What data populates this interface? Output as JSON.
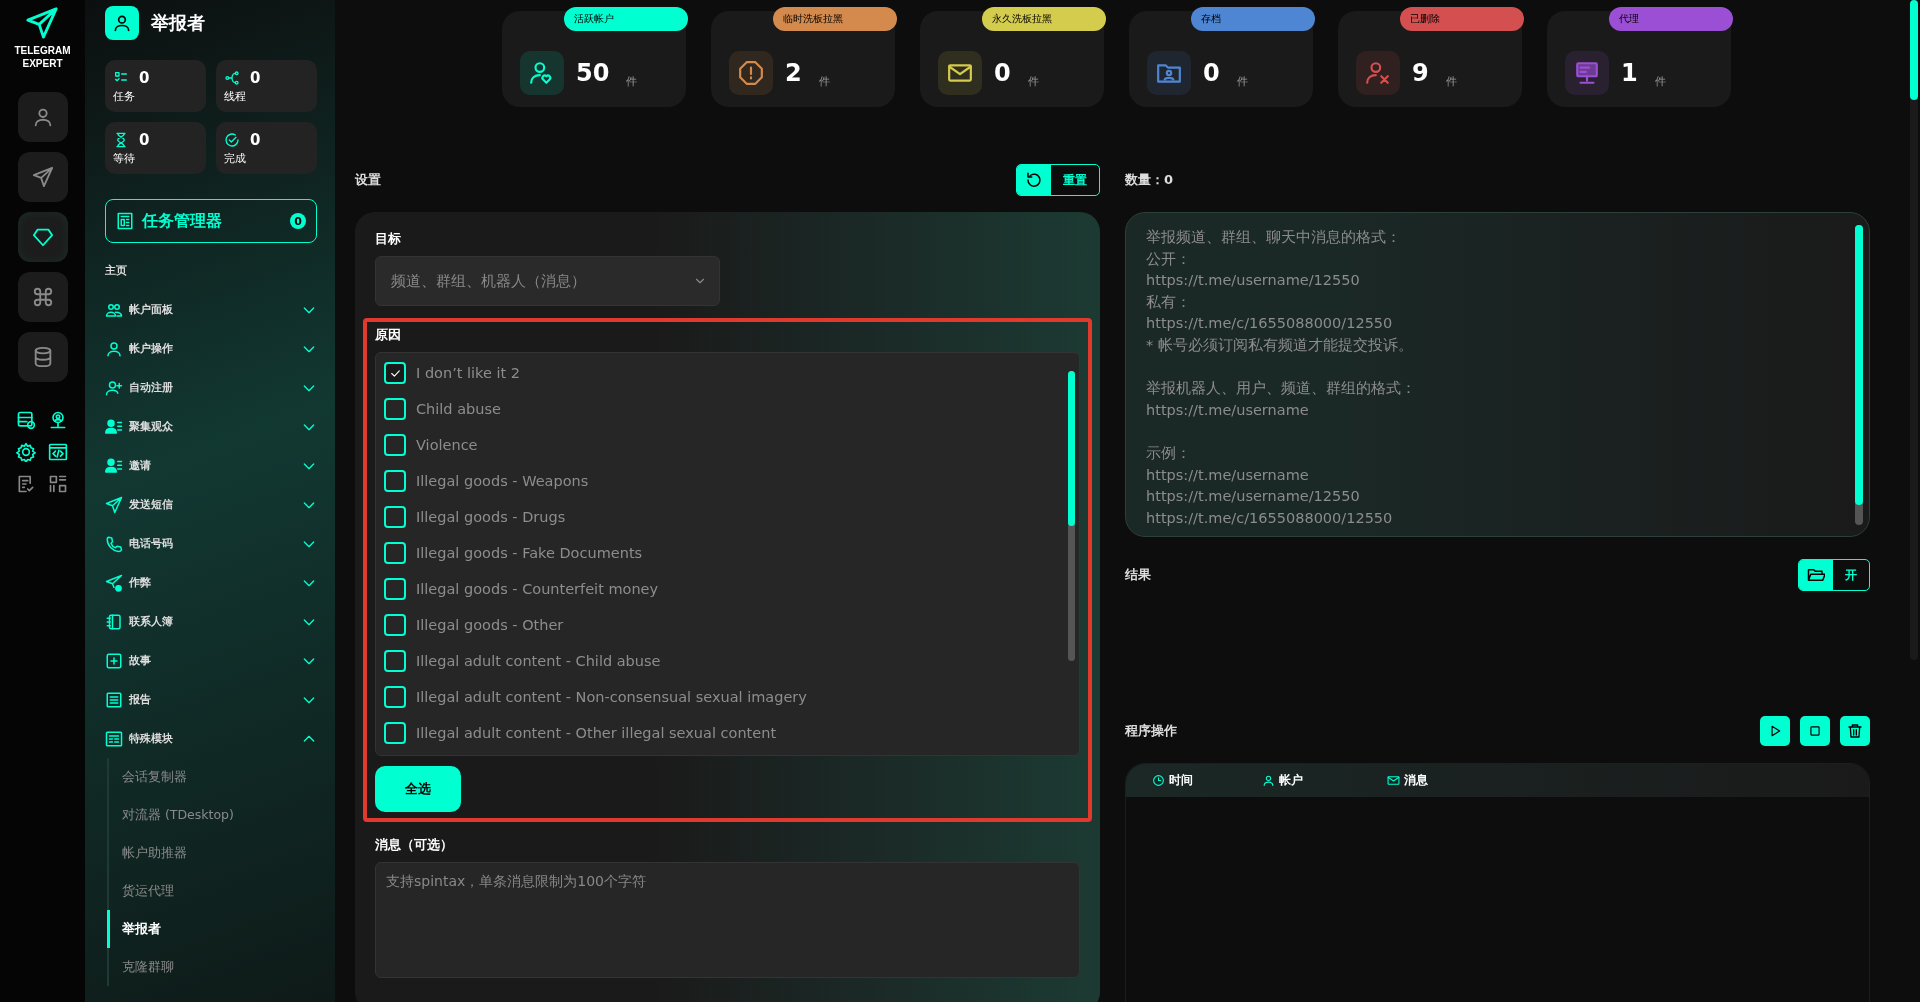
{
  "rail": {
    "logo_lines": [
      "TELEGRAM",
      "EXPERT"
    ],
    "buttons": [
      {
        "kind": "user",
        "selected": false
      },
      {
        "kind": "send",
        "selected": false
      },
      {
        "kind": "diamond",
        "selected": true
      },
      {
        "kind": "command",
        "selected": false
      },
      {
        "kind": "database",
        "selected": false
      }
    ],
    "tools": [
      {
        "kind": "server"
      },
      {
        "kind": "proxy"
      },
      {
        "kind": "gear"
      },
      {
        "kind": "code"
      },
      {
        "kind": "checklist"
      },
      {
        "kind": "grid"
      }
    ]
  },
  "sidebar": {
    "title": "举报者",
    "stats": [
      {
        "kind": "tasks",
        "value": "0",
        "label": "任务"
      },
      {
        "kind": "threads",
        "value": "0",
        "label": "线程"
      },
      {
        "kind": "waiting",
        "value": "0",
        "label": "等待"
      },
      {
        "kind": "done",
        "value": "0",
        "label": "完成"
      }
    ],
    "task_manager": {
      "label": "任务管理器",
      "count": "0"
    },
    "section": "主页",
    "menu": [
      {
        "kind": "users",
        "label": "帐户面板",
        "expanded": false
      },
      {
        "kind": "user",
        "label": "帐户操作",
        "expanded": false
      },
      {
        "kind": "user-plus",
        "label": "自动注册",
        "expanded": false
      },
      {
        "kind": "audience",
        "label": "聚集观众",
        "expanded": false
      },
      {
        "kind": "audience",
        "label": "邀请",
        "expanded": false
      },
      {
        "kind": "send",
        "label": "发送短信",
        "expanded": false
      },
      {
        "kind": "phone",
        "label": "电话号码",
        "expanded": false
      },
      {
        "kind": "send-plus",
        "label": "作弊",
        "expanded": false
      },
      {
        "kind": "book",
        "label": "联系人簿",
        "expanded": false
      },
      {
        "kind": "plus-box",
        "label": "故事",
        "expanded": false
      },
      {
        "kind": "report",
        "label": "报告",
        "expanded": false
      },
      {
        "kind": "table",
        "label": "特殊模块",
        "expanded": true,
        "children": [
          {
            "label": "会话复制器",
            "selected": false
          },
          {
            "label": "对流器 (TDesktop)",
            "selected": false
          },
          {
            "label": "帐户助推器",
            "selected": false
          },
          {
            "label": "货运代理",
            "selected": false
          },
          {
            "label": "举报者",
            "selected": true
          },
          {
            "label": "克隆群聊",
            "selected": false
          }
        ]
      }
    ]
  },
  "stats": [
    {
      "kind": "active",
      "label": "活跃帐户",
      "color": "#00ffd1",
      "value": "50",
      "unit": "件"
    },
    {
      "kind": "warning",
      "label": "临时洗板拉黑",
      "color": "#d48a4c",
      "value": "2",
      "unit": "件"
    },
    {
      "kind": "mail",
      "label": "永久洗板拉黑",
      "color": "#d4cc4c",
      "value": "0",
      "unit": "件"
    },
    {
      "kind": "folder",
      "label": "存档",
      "color": "#4f86d4",
      "value": "0",
      "unit": "件"
    },
    {
      "kind": "deleted",
      "label": "已删除",
      "color": "#d44f4f",
      "value": "9",
      "unit": "件"
    },
    {
      "kind": "proxy",
      "label": "代理",
      "color": "#9b4fd4",
      "value": "1",
      "unit": "件"
    }
  ],
  "settings": {
    "title": "设置",
    "reset": "重置",
    "target_label": "目标",
    "target_value": "频道、群组、机器人（消息）",
    "reason_label": "原因",
    "reasons": [
      {
        "label": "I don’t like it 2",
        "checked": true
      },
      {
        "label": "Child abuse",
        "checked": false
      },
      {
        "label": "Violence",
        "checked": false
      },
      {
        "label": "Illegal goods - Weapons",
        "checked": false
      },
      {
        "label": "Illegal goods - Drugs",
        "checked": false
      },
      {
        "label": "Illegal goods - Fake Documents",
        "checked": false
      },
      {
        "label": "Illegal goods - Counterfeit money",
        "checked": false
      },
      {
        "label": "Illegal goods - Other",
        "checked": false
      },
      {
        "label": "Illegal adult content - Child abuse",
        "checked": false
      },
      {
        "label": "Illegal adult content - Non-consensual sexual imagery",
        "checked": false
      },
      {
        "label": "Illegal adult content - Other illegal sexual content",
        "checked": false
      }
    ],
    "select_all": "全选",
    "message_label": "消息（可选）",
    "message_placeholder": "支持spintax，单条消息限制为100个字符"
  },
  "right": {
    "count": "数量：0",
    "input_blocks": [
      [
        "举报频道、群组、聊天中消息的格式：",
        "公开：",
        "https://t.me/username/12550",
        "私有：",
        "https://t.me/c/1655088000/12550",
        "* 帐号必须订阅私有频道才能提交投诉。"
      ],
      [
        "举报机器人、用户、频道、群组的格式：",
        "https://t.me/username"
      ],
      [
        "示例：",
        "https://t.me/username",
        "https://t.me/username/12550",
        "https://t.me/c/1655088000/12550"
      ]
    ],
    "results_title": "结果",
    "open": "开",
    "ops_title": "程序操作",
    "log_columns": [
      {
        "kind": "time",
        "label": "时间"
      },
      {
        "kind": "user",
        "label": "帐户"
      },
      {
        "kind": "mail",
        "label": "消息"
      }
    ]
  }
}
